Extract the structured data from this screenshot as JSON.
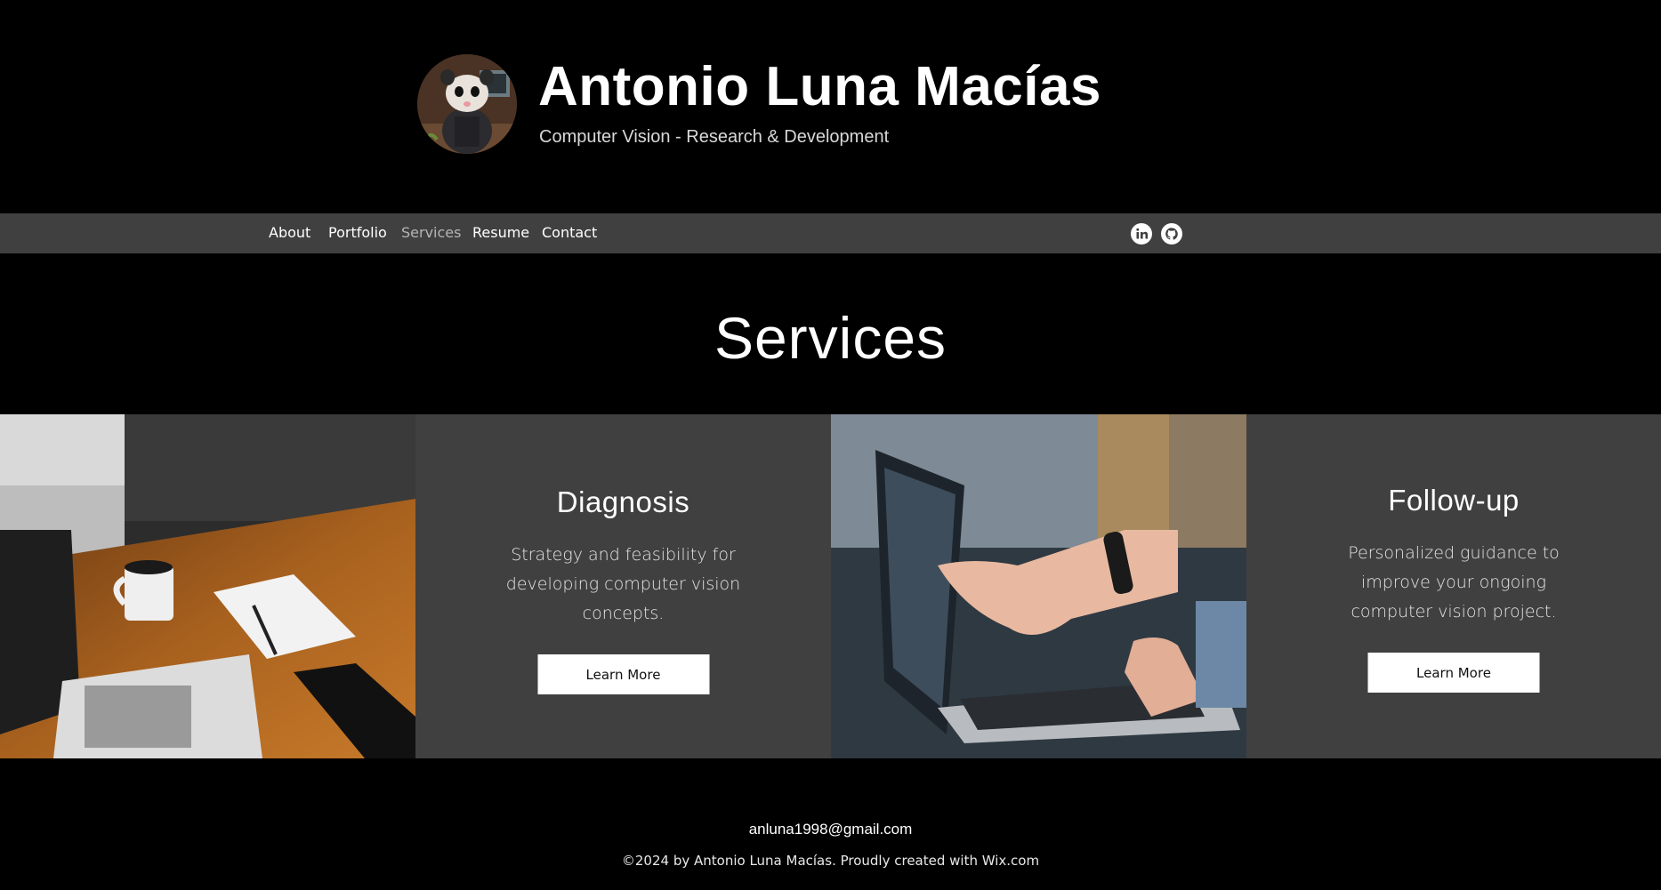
{
  "header": {
    "title": "Antonio Luna Macías",
    "tagline": "Computer Vision - Research & Development",
    "avatar_icon": "opossum-avatar"
  },
  "nav": {
    "items": [
      {
        "label": "About",
        "active": false
      },
      {
        "label": "Portfolio",
        "active": false
      },
      {
        "label": "Services",
        "active": true
      },
      {
        "label": "Resume",
        "active": false
      },
      {
        "label": "Contact",
        "active": false
      }
    ],
    "social": [
      {
        "icon": "linkedin-icon"
      },
      {
        "icon": "github-icon"
      }
    ]
  },
  "page": {
    "title": "Services"
  },
  "services": [
    {
      "title": "Diagnosis",
      "description": "Strategy and feasibility for developing computer vision concepts.",
      "button_label": "Learn More",
      "image": "desk-laptop-coffee-photo"
    },
    {
      "title": "Follow-up",
      "description": "Personalized guidance to improve your ongoing computer vision project.",
      "button_label": "Learn More",
      "image": "laptop-pointing-hands-photo"
    }
  ],
  "footer": {
    "email": "anluna1998@gmail.com",
    "copyright": "©2024 by Antonio Luna Macías. Proudly created with Wix.com"
  },
  "colors": {
    "background": "#000000",
    "navbar": "#404040",
    "tile": "#404040",
    "button": "#ffffff",
    "nav_active": "#b5b5b5"
  }
}
